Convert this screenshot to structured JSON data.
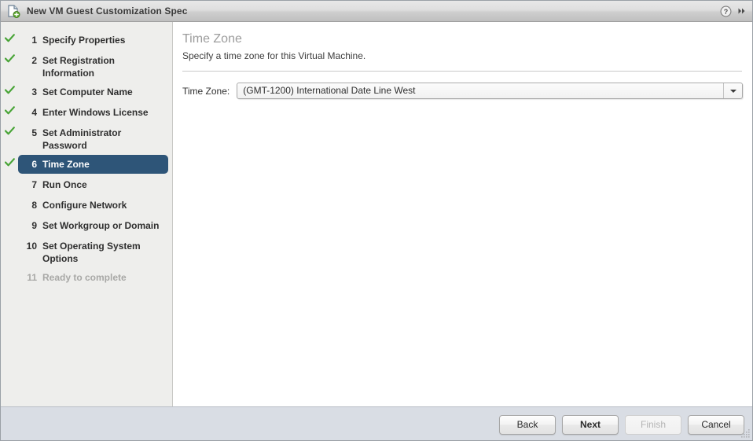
{
  "window": {
    "title": "New VM Guest Customization Spec",
    "icon": "new-document-icon",
    "help_icon": "help-icon",
    "expand_icon": "double-chevron-right-icon",
    "resize_grip": "resize-grip-icon"
  },
  "sidebar": {
    "steps": [
      {
        "number": "1",
        "label": "Specify Properties",
        "state": "complete"
      },
      {
        "number": "2",
        "label": "Set Registration Information",
        "state": "complete"
      },
      {
        "number": "3",
        "label": "Set Computer Name",
        "state": "complete"
      },
      {
        "number": "4",
        "label": "Enter Windows License",
        "state": "complete"
      },
      {
        "number": "5",
        "label": "Set Administrator Password",
        "state": "complete"
      },
      {
        "number": "6",
        "label": "Time Zone",
        "state": "current"
      },
      {
        "number": "7",
        "label": "Run Once",
        "state": "pending"
      },
      {
        "number": "8",
        "label": "Configure Network",
        "state": "pending"
      },
      {
        "number": "9",
        "label": "Set Workgroup or Domain",
        "state": "pending"
      },
      {
        "number": "10",
        "label": "Set Operating System\nOptions",
        "state": "pending"
      },
      {
        "number": "11",
        "label": "Ready to complete",
        "state": "disabled"
      }
    ]
  },
  "content": {
    "title": "Time Zone",
    "subtitle": "Specify a time zone for this Virtual Machine.",
    "timezone_label": "Time Zone:",
    "timezone_value": "(GMT-1200) International Date Line West",
    "timezone_arrow_icon": "chevron-down-icon"
  },
  "footer": {
    "back": "Back",
    "next": "Next",
    "finish": "Finish",
    "cancel": "Cancel"
  },
  "colors": {
    "accent": "#2e5578",
    "check": "#48a436",
    "footer_bg": "#d9dde4",
    "sidebar_bg": "#eeeeec"
  }
}
